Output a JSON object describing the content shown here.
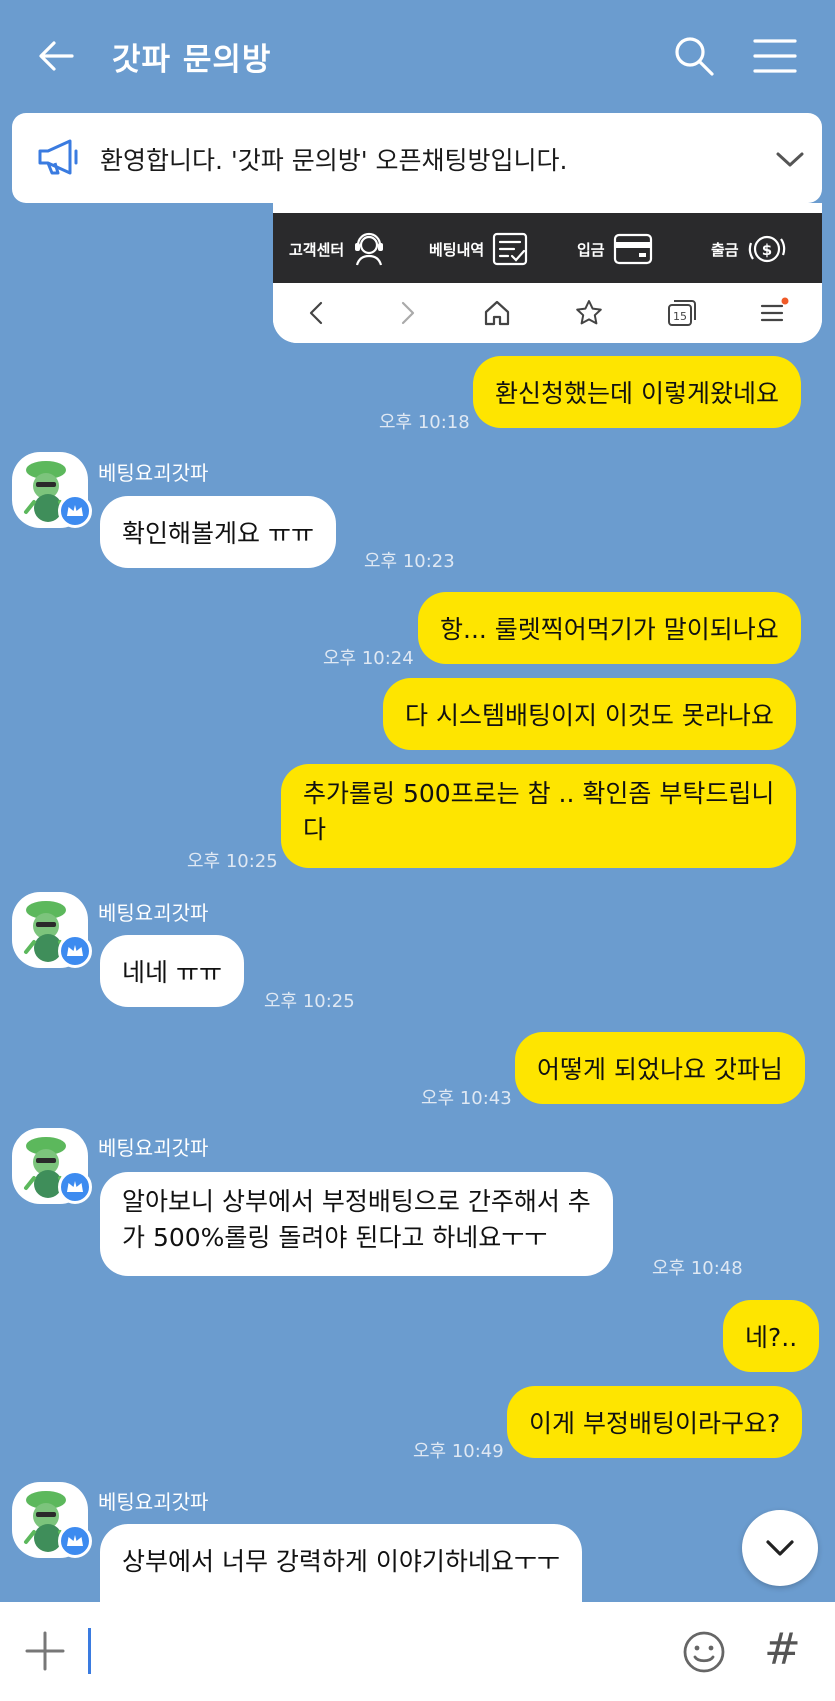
{
  "header": {
    "title": "갓파 문의방"
  },
  "notice": {
    "text": "환영합니다. '갓파 문의방' 오픈채팅방입니다."
  },
  "image_bubble": {
    "menu": [
      {
        "label": "고객센터",
        "icon": "headset-icon"
      },
      {
        "label": "베팅내역",
        "icon": "checklist-icon"
      },
      {
        "label": "입금",
        "icon": "card-icon"
      },
      {
        "label": "출금",
        "icon": "dollar-cycle-icon"
      }
    ],
    "tab_count": "15"
  },
  "sender_name": "베팅요괴갓파",
  "messages": [
    {
      "side": "right",
      "text": "환신청했는데 이렇게왔네요",
      "time": "오후 10:18"
    },
    {
      "side": "left",
      "text": "확인해볼게요 ㅠㅠ",
      "time": "오후 10:23"
    },
    {
      "side": "right",
      "text": "항... 룰렛찍어먹기가 말이되나요",
      "time": "오후 10:24"
    },
    {
      "side": "right",
      "text": "다 시스템배팅이지 이것도 못라나요",
      "time": ""
    },
    {
      "side": "right",
      "text": "추가롤링 500프로는 참 .. 확인좀 부탁드립니다",
      "line1": "추가롤링 500프로는 참 .. 확인좀 부탁드립니",
      "line2": "다",
      "time": "오후 10:25"
    },
    {
      "side": "left",
      "text": "네네 ㅠㅠ",
      "time": "오후 10:25"
    },
    {
      "side": "right",
      "text": "어떻게 되었나요 갓파님",
      "time": "오후 10:43"
    },
    {
      "side": "left",
      "text": "알아보니 상부에서 부정배팅으로 간주해서 추가 500%롤링 돌려야 된다고 하네요ㅜㅜ",
      "line1": "알아보니 상부에서 부정배팅으로 간주해서 추",
      "line2": "가 500%롤링 돌려야 된다고 하네요ㅜㅜ",
      "time": "오후 10:48"
    },
    {
      "side": "right",
      "text": "네?..",
      "time": ""
    },
    {
      "side": "right",
      "text": "이게 부정배팅이라구요?",
      "time": "오후 10:49"
    },
    {
      "side": "left",
      "text": "상부에서 너무 강력하게 이야기하네요ㅜㅜ",
      "time": ""
    }
  ],
  "colors": {
    "background": "#6b9ccf",
    "my_bubble": "#fee500",
    "other_bubble": "#ffffff"
  }
}
